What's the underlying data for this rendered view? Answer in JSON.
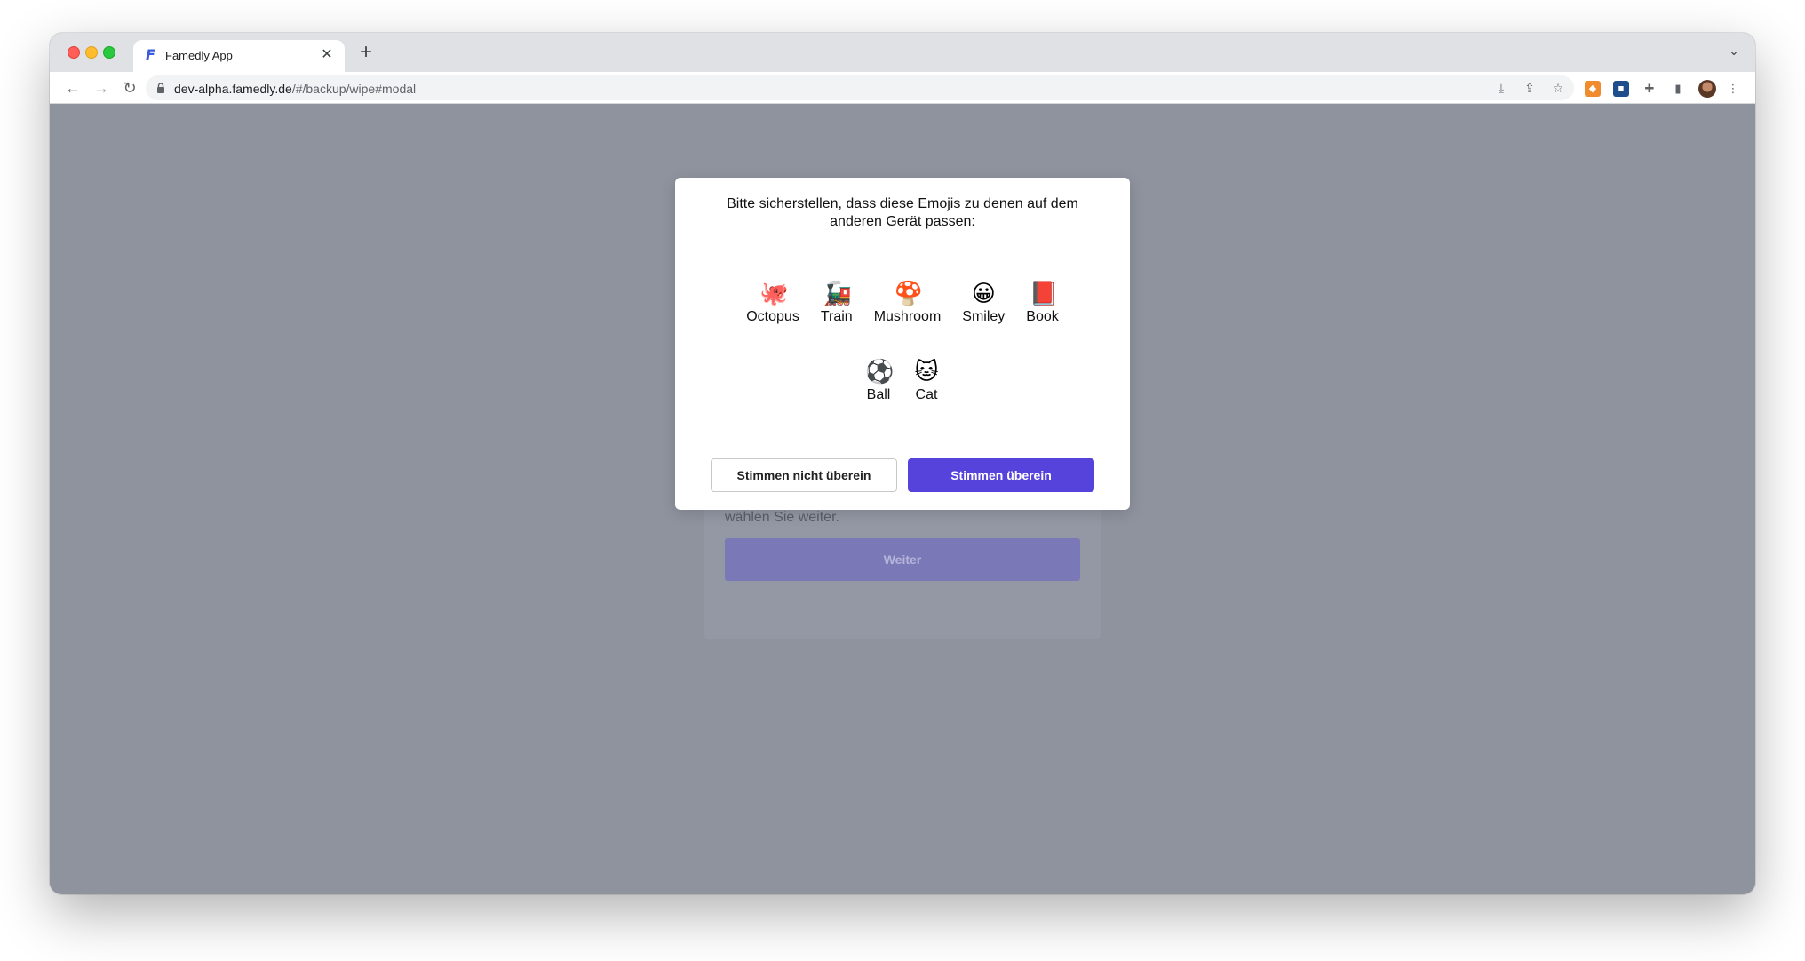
{
  "browser": {
    "tab": {
      "title": "Famedly App",
      "favicon": "famedly-logo"
    },
    "new_tab": "+",
    "url": {
      "domain": "dev-alpha.famedly.de",
      "path": "/#/backup/wipe#modal"
    }
  },
  "background": {
    "text": "Geben Sie die URL und Anmeldedaten ein, um sich in der Famedly App anzumelden. Anschließend klicken wählen Sie weiter.",
    "button": "Weiter"
  },
  "modal": {
    "title": "Bitte sicherstellen, dass diese Emojis zu denen auf dem anderen Gerät passen:",
    "emojis_row1": [
      {
        "glyph": "🐙",
        "label": "Octopus"
      },
      {
        "glyph": "🚂",
        "label": "Train"
      },
      {
        "glyph": "🍄",
        "label": "Mushroom"
      },
      {
        "glyph": "😀",
        "label": "Smiley"
      },
      {
        "glyph": "📕",
        "label": "Book"
      }
    ],
    "emojis_row2": [
      {
        "glyph": "⚽",
        "label": "Ball"
      },
      {
        "glyph": "🐱",
        "label": "Cat"
      }
    ],
    "mismatch_button": "Stimmen nicht überein",
    "match_button": "Stimmen überein"
  },
  "colors": {
    "accent": "#5643dc",
    "overlay": "#8f939e"
  }
}
